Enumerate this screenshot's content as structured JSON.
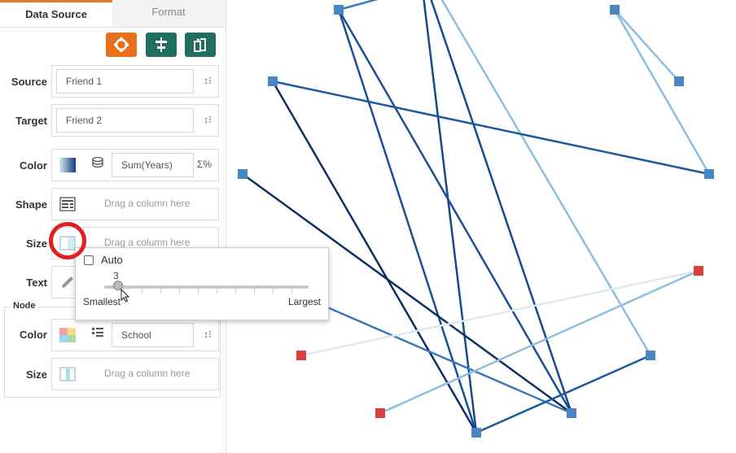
{
  "tabs": {
    "data_source": "Data Source",
    "format": "Format"
  },
  "toolbar": {
    "buttons": [
      {
        "name": "layout-button",
        "color": "#e8701a"
      },
      {
        "name": "filter-button",
        "color": "#1f6e5e"
      },
      {
        "name": "swap-button",
        "color": "#1f6e5e"
      }
    ]
  },
  "fields": {
    "source": {
      "label": "Source",
      "value": "Friend 1"
    },
    "target": {
      "label": "Target",
      "value": "Friend 2"
    },
    "color": {
      "label": "Color",
      "value": "Sum(Years)"
    },
    "shape": {
      "label": "Shape",
      "placeholder": "Drag a column here"
    },
    "size": {
      "label": "Size",
      "placeholder": "Drag a column here"
    },
    "text": {
      "label": "Text"
    }
  },
  "node": {
    "legend": "Node",
    "color": {
      "label": "Color",
      "value": "School"
    },
    "size": {
      "label": "Size",
      "placeholder": "Drag a column here"
    }
  },
  "size_popup": {
    "auto_label": "Auto",
    "auto_checked": false,
    "value": "3",
    "min_label": "Smallest",
    "max_label": "Largest"
  },
  "colors": {
    "accent_orange": "#e87722",
    "teal": "#1f6e5e",
    "node_blue": "#4a86c0",
    "node_red": "#d94040",
    "highlight_red": "#e01f1f"
  },
  "network_nodes": [
    {
      "id": "n1",
      "color": "blue"
    },
    {
      "id": "n2",
      "color": "blue"
    },
    {
      "id": "n3",
      "color": "blue"
    },
    {
      "id": "n4",
      "color": "blue"
    },
    {
      "id": "n5",
      "color": "blue"
    },
    {
      "id": "n6",
      "color": "blue"
    },
    {
      "id": "n7",
      "color": "red"
    },
    {
      "id": "n8",
      "color": "red"
    },
    {
      "id": "n9",
      "color": "blue"
    },
    {
      "id": "n10",
      "color": "red"
    },
    {
      "id": "n11",
      "color": "blue"
    },
    {
      "id": "n12",
      "color": "blue"
    }
  ]
}
